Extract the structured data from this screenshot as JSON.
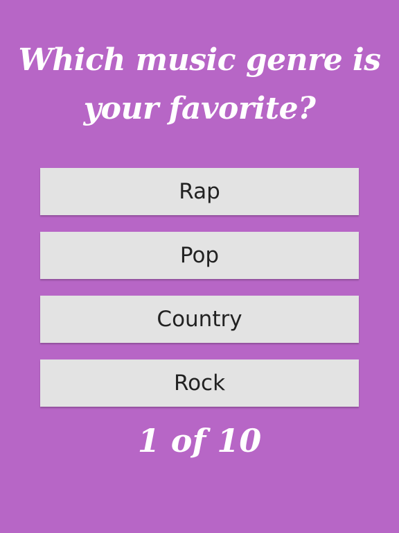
{
  "question": {
    "text": "Which music genre is your favorite?"
  },
  "answers": [
    {
      "label": "Rap"
    },
    {
      "label": "Pop"
    },
    {
      "label": "Country"
    },
    {
      "label": "Rock"
    }
  ],
  "progress": {
    "text": "1 of 10"
  },
  "colors": {
    "background": "#b766c6",
    "button": "#e3e3e3",
    "button_text": "#222222",
    "title_text": "#ffffff"
  }
}
